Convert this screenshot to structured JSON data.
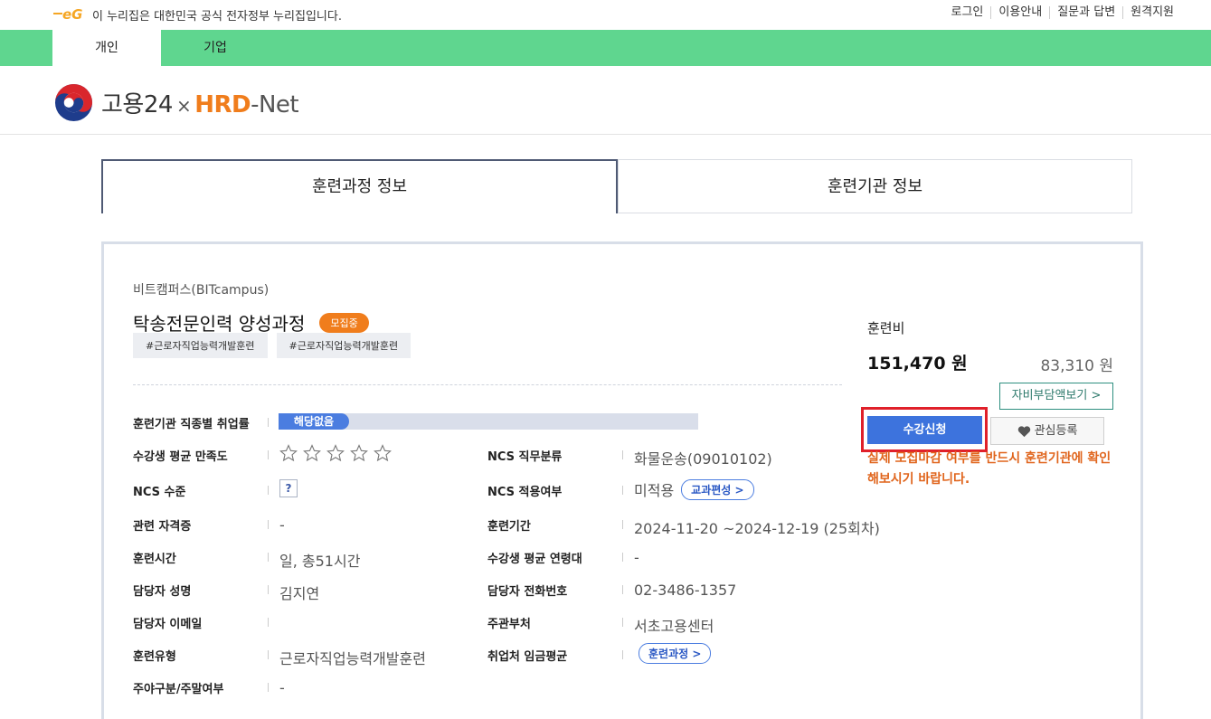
{
  "topbar": {
    "gov_notice": "이 누리집은 대한민국 공식 전자정부 누리집입니다.",
    "links": [
      "로그인",
      "이용안내",
      "질문과 답변",
      "원격지원"
    ]
  },
  "user_tabs": [
    "개인",
    "기업"
  ],
  "brand": {
    "part1": "고용24",
    "x": "×",
    "part2": "HRD",
    "part3": "-Net"
  },
  "content_tabs": [
    "훈련과정 정보",
    "훈련기관 정보"
  ],
  "course": {
    "institution": "비트캠퍼스(BITcampus)",
    "title": "탁송전문인력 양성과정",
    "status_badge": "모집중",
    "tags": [
      "#근로자직업능력개발훈련",
      "#근로자직업능력개발훈련"
    ]
  },
  "details": {
    "employment_rate": {
      "label": "훈련기관 직종별 취업률",
      "value": "해당없음"
    },
    "satisfaction": {
      "label": "수강생 평균 만족도",
      "stars_filled": 0,
      "stars_total": 5
    },
    "ncs_category": {
      "label": "NCS 직무분류",
      "value": "화물운송(09010102)"
    },
    "ncs_level": {
      "label": "NCS 수준",
      "value": "?"
    },
    "ncs_applied": {
      "label": "NCS 적용여부",
      "value": "미적용",
      "button": "교과편성 >"
    },
    "certificate": {
      "label": "관련 자격증",
      "value": "-"
    },
    "period": {
      "label": "훈련기간",
      "value": "2024-11-20 ~2024-12-19 (25회차)"
    },
    "hours": {
      "label": "훈련시간",
      "value": "일, 총51시간"
    },
    "avg_age": {
      "label": "수강생 평균 연령대",
      "value": "-"
    },
    "manager_name": {
      "label": "담당자 성명",
      "value": "김지연"
    },
    "manager_phone": {
      "label": "담당자 전화번호",
      "value": "02-3486-1357"
    },
    "manager_email": {
      "label": "담당자 이메일",
      "value": ""
    },
    "department": {
      "label": "주관부처",
      "value": "서초고용센터"
    },
    "training_type": {
      "label": "훈련유형",
      "value": "근로자직업능력개발훈련"
    },
    "avg_wage": {
      "label": "취업처 임금평균",
      "button": "훈련과정 >"
    },
    "day_night": {
      "label": "주야구분/주말여부",
      "value": "-"
    }
  },
  "fees": {
    "label": "훈련비",
    "total": "151,470 원",
    "self_pay": "83,310 원",
    "copay_button": "자비부담액보기 >",
    "apply_button": "수강신청",
    "favorite_button": "관심등록",
    "notice": "실제 모집마감 여부를 반드시 훈련기관에 확인해보시기 바랍니다."
  },
  "colors": {
    "green_bar": "#5fd68f",
    "brand_orange": "#f07d1c",
    "apply_blue": "#3d73dd",
    "highlight_red": "#e0202a",
    "notice_orange": "#e0651d"
  }
}
